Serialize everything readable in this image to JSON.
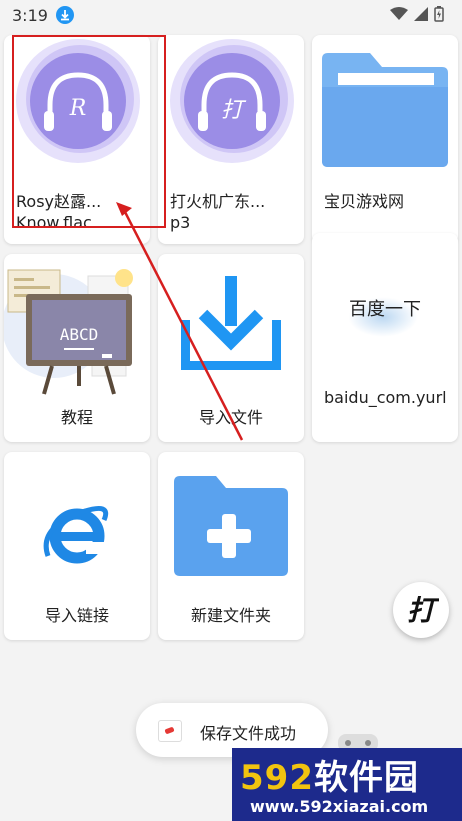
{
  "status_bar": {
    "time": "3:19"
  },
  "files": [
    {
      "label": "Rosy赵露...\nKnow.flac",
      "icon": "music-headphones-icon"
    },
    {
      "label": "打火机广东...\np3",
      "icon": "music-headphones-icon"
    },
    {
      "label": "宝贝游戏网",
      "icon": "folder-icon"
    },
    {
      "label": "教程",
      "icon": "tutorial-blackboard-icon"
    },
    {
      "label": "导入文件",
      "icon": "import-download-icon"
    },
    {
      "label": "baidu_com.yurl",
      "icon": "web-shortcut-icon"
    },
    {
      "label": "导入链接",
      "icon": "ie-browser-icon"
    },
    {
      "label": "新建文件夹",
      "icon": "new-folder-icon"
    }
  ],
  "icon_text": {
    "note1": "R",
    "note2": "打",
    "board": "ABCD",
    "baidu": "百度一下",
    "fab": "打"
  },
  "toast": {
    "text": "保存文件成功"
  },
  "watermark": {
    "brand_num": "592",
    "brand_cn": "软件园",
    "url": "www.592xiazai.com"
  },
  "colors": {
    "accent_red": "#d61f1f",
    "music_purple": "#9b8de6",
    "folder_blue": "#78b4f2",
    "import_blue": "#1f96f3",
    "watermark_bg": "#1d2a8c"
  }
}
